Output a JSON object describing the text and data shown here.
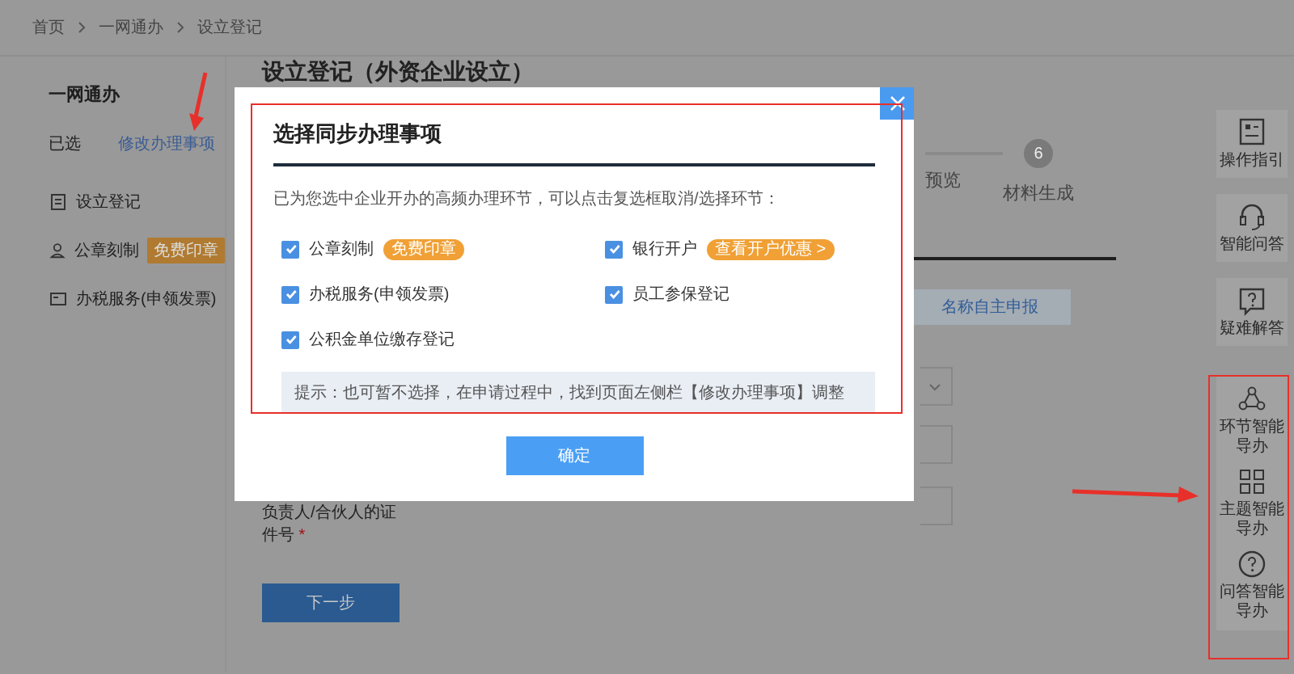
{
  "breadcrumb": [
    "首页",
    "一网通办",
    "设立登记"
  ],
  "sidebar": {
    "title": "一网通办",
    "selected_label": "已选",
    "edit_link": "修改办理事项",
    "items": [
      {
        "label": "设立登记",
        "kind": "document"
      },
      {
        "label": "公章刻制",
        "kind": "person",
        "badge": "免费印章"
      },
      {
        "label": "办税服务(申领发票)",
        "kind": "card"
      }
    ]
  },
  "main": {
    "title": "设立登记（外资企业设立）",
    "steps": [
      {
        "label": "预览"
      },
      {
        "number": "6",
        "label": "材料生成"
      }
    ],
    "mode_button": "名称自主申报",
    "field_label": "负责人/合伙人的证件号",
    "required_mark": "*",
    "next_button": "下一步"
  },
  "toolbar": {
    "items": [
      {
        "label": "操作指引",
        "kind": "guide"
      },
      {
        "label": "智能问答",
        "kind": "headset"
      },
      {
        "label": "疑难解答",
        "kind": "question-box"
      }
    ],
    "smart_items": [
      {
        "label": "环节智能导办",
        "kind": "nodes"
      },
      {
        "label": "主题智能导办",
        "kind": "grid"
      },
      {
        "label": "问答智能导办",
        "kind": "question-circle"
      }
    ]
  },
  "modal": {
    "title": "选择同步办理事项",
    "description": "已为您选中企业开办的高频办理环节，可以点击复选框取消/选择环节：",
    "options": [
      {
        "label": "公章刻制",
        "checked": true,
        "badge": "免费印章"
      },
      {
        "label": "银行开户",
        "checked": true,
        "badge": "查看开户优惠 >"
      },
      {
        "label": "办税服务(申领发票)",
        "checked": true
      },
      {
        "label": "员工参保登记",
        "checked": true
      },
      {
        "label": "公积金单位缴存登记",
        "checked": true
      }
    ],
    "hint": "提示：也可暂不选择，在申请过程中，找到页面左侧栏【修改办理事项】调整",
    "confirm_button": "确定"
  }
}
